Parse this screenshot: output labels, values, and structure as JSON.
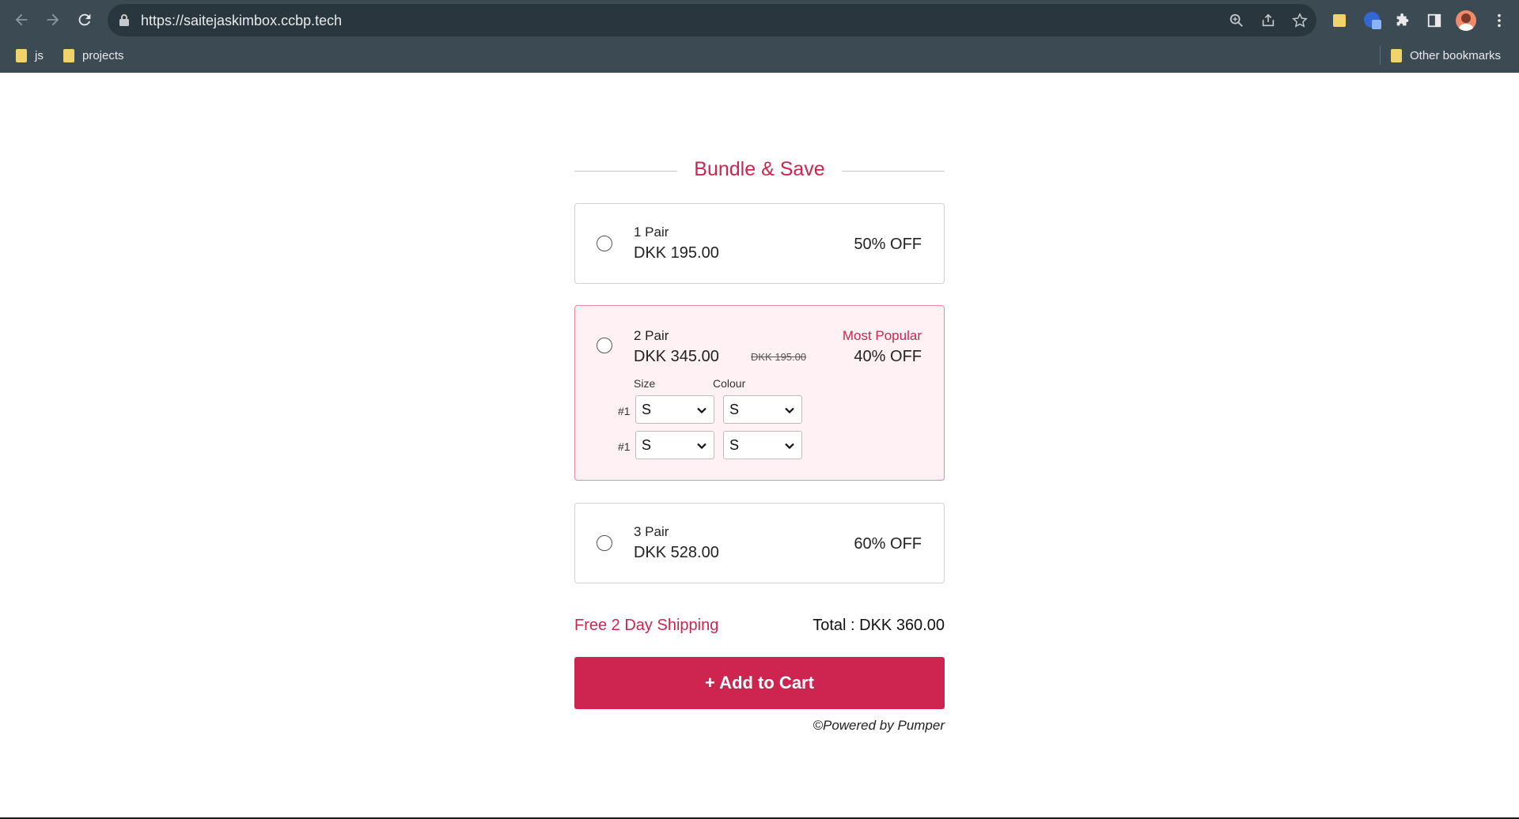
{
  "browser": {
    "url": "https://saitejaskimbox.ccbp.tech",
    "bookmarks": [
      {
        "label": "js"
      },
      {
        "label": "projects"
      }
    ],
    "other_bookmarks": "Other bookmarks",
    "icons": [
      "back-icon",
      "forward-icon",
      "reload-icon",
      "lock-icon",
      "zoom-icon",
      "share-icon",
      "star-icon",
      "extension-note-icon",
      "extension-app-icon",
      "puzzle-icon",
      "side-panel-icon",
      "avatar",
      "menu-icon"
    ]
  },
  "page": {
    "heading": "Bundle & Save",
    "options": [
      {
        "label": "1 Pair",
        "price": "DKK 195.00",
        "discount": "50% OFF",
        "selected": false
      },
      {
        "label": "2 Pair",
        "price": "DKK 345.00",
        "original_price": "DKK 195.00",
        "badge": "Most Popular",
        "discount": "40% OFF",
        "selected": false,
        "size_header": "Size",
        "colour_header": "Colour",
        "rows": [
          {
            "num": "#1",
            "size": "S",
            "colour": "S"
          },
          {
            "num": "#1",
            "size": "S",
            "colour": "S"
          }
        ]
      },
      {
        "label": "3 Pair",
        "price": "DKK 528.00",
        "discount": "60% OFF",
        "selected": false
      }
    ],
    "shipping": "Free 2 Day Shipping",
    "total": "Total : DKK 360.00",
    "cart_button": "+ Add to Cart",
    "powered_by": "©Powered by Pumper"
  },
  "colors": {
    "accent": "#cc2650",
    "active_card_bg": "#fff1f4",
    "chrome_bg": "#3c4a54"
  }
}
